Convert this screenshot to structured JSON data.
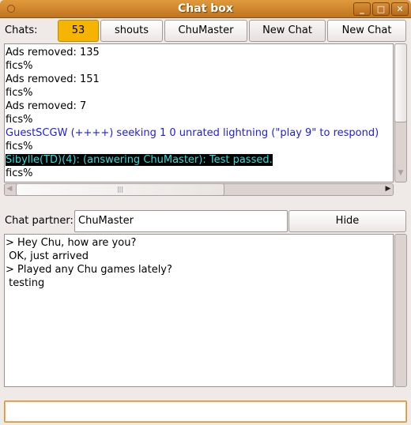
{
  "window": {
    "title": "Chat box",
    "minimize": "_",
    "maximize": "□",
    "close": "✕"
  },
  "chats": {
    "label": "Chats:",
    "tabs": [
      {
        "label": "53",
        "active": true
      },
      {
        "label": "shouts"
      },
      {
        "label": "ChuMaster"
      },
      {
        "label": "New Chat"
      },
      {
        "label": "New Chat"
      }
    ]
  },
  "console": {
    "lines": [
      {
        "text": "Ads removed: 135",
        "style": "normal"
      },
      {
        "text": "fics%",
        "style": "normal"
      },
      {
        "text": "Ads removed: 151",
        "style": "normal"
      },
      {
        "text": "fics%",
        "style": "normal"
      },
      {
        "text": "Ads removed: 7",
        "style": "normal"
      },
      {
        "text": "fics%",
        "style": "normal"
      },
      {
        "text": "GuestSCGW (++++) seeking 1 0 unrated lightning (\"play 9\" to respond)",
        "style": "blue"
      },
      {
        "text": "fics%",
        "style": "normal"
      },
      {
        "text": "Sibylle(TD)(4): (answering ChuMaster): Test passed.",
        "style": "highlight"
      },
      {
        "text": "fics%",
        "style": "normal"
      }
    ]
  },
  "partner": {
    "label": "Chat partner:",
    "value": "ChuMaster",
    "hide_label": "Hide"
  },
  "chat": {
    "lines": [
      "> Hey Chu, how are you?",
      " OK, just arrived",
      "> Played any Chu games lately?",
      " testing"
    ]
  },
  "input": {
    "value": ""
  }
}
